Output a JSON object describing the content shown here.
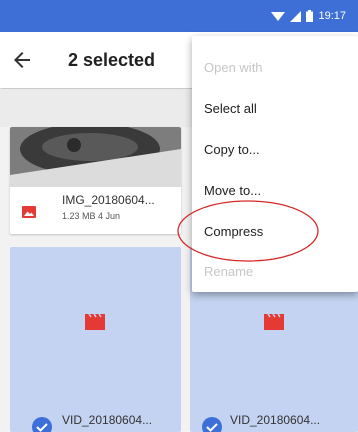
{
  "status_bar": {
    "time": "19:17",
    "icons": [
      "wifi-icon",
      "signal-icon",
      "battery-icon"
    ]
  },
  "app_bar": {
    "back_icon": "arrow-back-icon",
    "title": "2 selected"
  },
  "files": [
    {
      "name": "IMG_20180604...",
      "meta": "1.23 MB 4 Jun",
      "type": "image",
      "selected": false
    },
    {
      "name": "VID_20180604...",
      "type": "video",
      "selected": true
    },
    {
      "name": "VID_20180604...",
      "type": "video",
      "selected": true
    }
  ],
  "menu": {
    "items": [
      {
        "label": "Open with",
        "enabled": false
      },
      {
        "label": "Select all",
        "enabled": true
      },
      {
        "label": "Copy to...",
        "enabled": true
      },
      {
        "label": "Move to...",
        "enabled": true
      },
      {
        "label": "Compress",
        "enabled": true
      },
      {
        "label": "Rename",
        "enabled": false
      }
    ]
  },
  "colors": {
    "status_bar": "#3d6fd6",
    "selected_card": "#c4d3f1",
    "accent_blue": "#3c6fd8",
    "media_red": "#e53935",
    "annotation": "#d62828"
  }
}
